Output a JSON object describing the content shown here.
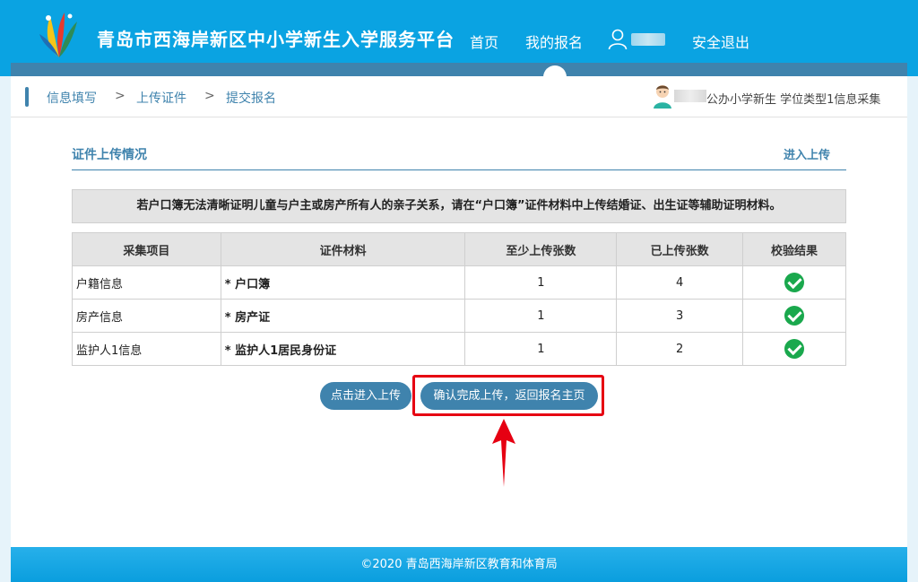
{
  "header": {
    "site_title": "青岛市西海岸新区中小学新生入学服务平台",
    "nav": {
      "home": "首页",
      "my_registration": "我的报名",
      "logout": "安全退出"
    }
  },
  "breadcrumb": [
    "信息填写",
    "上传证件",
    "提交报名"
  ],
  "breadcrumb_separator": ">",
  "student_info": "公办小学新生 学位类型1信息采集",
  "section": {
    "title": "证件上传情况",
    "enter_upload": "进入上传"
  },
  "notice": "若户口簿无法清晰证明儿童与户主或房产所有人的亲子关系，请在“户口簿”证件材料中上传结婚证、出生证等辅助证明材料。",
  "table": {
    "headers": [
      "采集项目",
      "证件材料",
      "至少上传张数",
      "已上传张数",
      "校验结果"
    ],
    "rows": [
      {
        "item": "户籍信息",
        "doc": "* 户口簿",
        "min": "1",
        "uploaded": "4"
      },
      {
        "item": "房产信息",
        "doc": "* 房产证",
        "min": "1",
        "uploaded": "3"
      },
      {
        "item": "监护人1信息",
        "doc": "* 监护人1居民身份证",
        "min": "1",
        "uploaded": "2"
      }
    ]
  },
  "buttons": {
    "enter_upload": "点击进入上传",
    "confirm": "确认完成上传，返回报名主页"
  },
  "footer": "©2020 青岛西海岸新区教育和体育局",
  "colors": {
    "header_bg": "#0aa3e2",
    "accent": "#3f83ad",
    "success": "#1aa84d",
    "highlight": "#e60012"
  }
}
